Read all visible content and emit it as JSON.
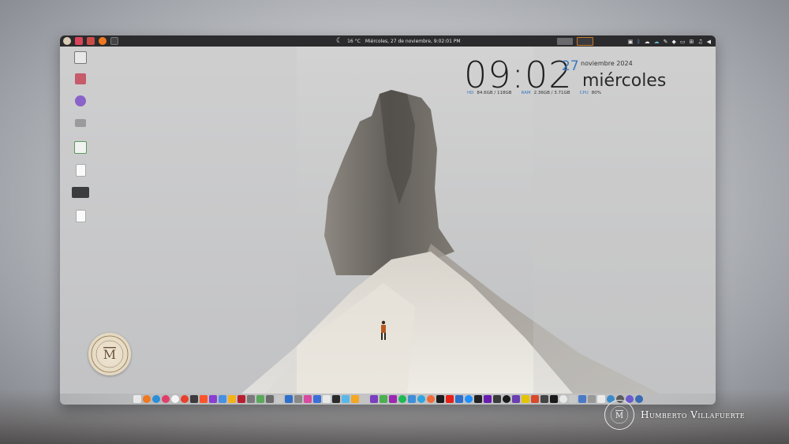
{
  "topbar": {
    "weather": "16 °C",
    "datetime": "Miércoles, 27 de noviembre, 9:02:01 PM"
  },
  "conky": {
    "time": "09:02",
    "day": "27",
    "month_year": "noviembre 2024",
    "weekday": "miércoles",
    "hd_label": "HD",
    "hd_value": "84.6GB / 118GB",
    "ram_label": "RAM",
    "ram_value": "2.36GB / 3.71GB",
    "cpu_label": "CPU",
    "cpu_value": "80%"
  },
  "watermark": {
    "name": "Humberto Villafuerte"
  },
  "colors": {
    "accent_blue": "#3a78c0",
    "topbar_bg": "#2b2b2d"
  }
}
